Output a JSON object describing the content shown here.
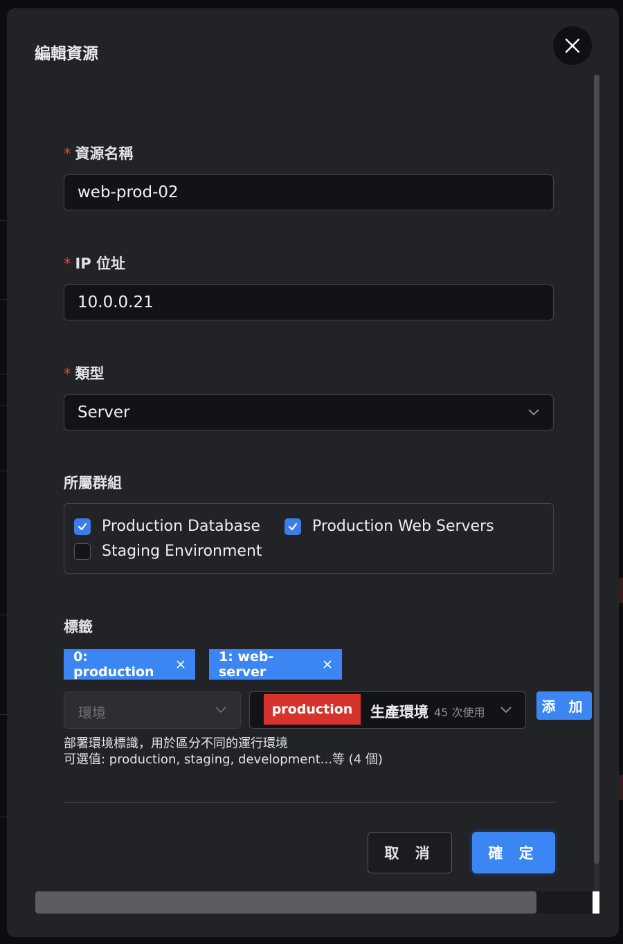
{
  "dialog": {
    "title": "編輯資源",
    "close_icon": "close-icon"
  },
  "fields": {
    "name": {
      "label": "資源名稱",
      "required_mark": "*",
      "value": "web-prod-02"
    },
    "ip": {
      "label": "IP 位址",
      "required_mark": "*",
      "value": "10.0.0.21"
    },
    "type": {
      "label": "類型",
      "required_mark": "*",
      "value": "Server"
    }
  },
  "groups": {
    "label": "所屬群組",
    "items": [
      {
        "label": "Production Database",
        "checked": true
      },
      {
        "label": "Production Web Servers",
        "checked": true
      },
      {
        "label": "Staging Environment",
        "checked": false
      }
    ]
  },
  "tags": {
    "label": "標籤",
    "items": [
      {
        "text": "0: production"
      },
      {
        "text": "1: web-server"
      }
    ],
    "key_select_placeholder": "環境",
    "value_select": {
      "chip": "production",
      "chip_color": "#d6332e",
      "name": "生產環境",
      "usage": "45 次使用"
    },
    "add_label": "添 加",
    "hint_line1": "部署環境標識，用於區分不同的運行環境",
    "hint_line2": "可選值: production, staging, development...等 (4 個)"
  },
  "footer": {
    "cancel_label": "取 消",
    "ok_label": "確 定"
  },
  "colors": {
    "accent": "#3b86f2",
    "danger": "#d6332e",
    "background": "#212327"
  }
}
